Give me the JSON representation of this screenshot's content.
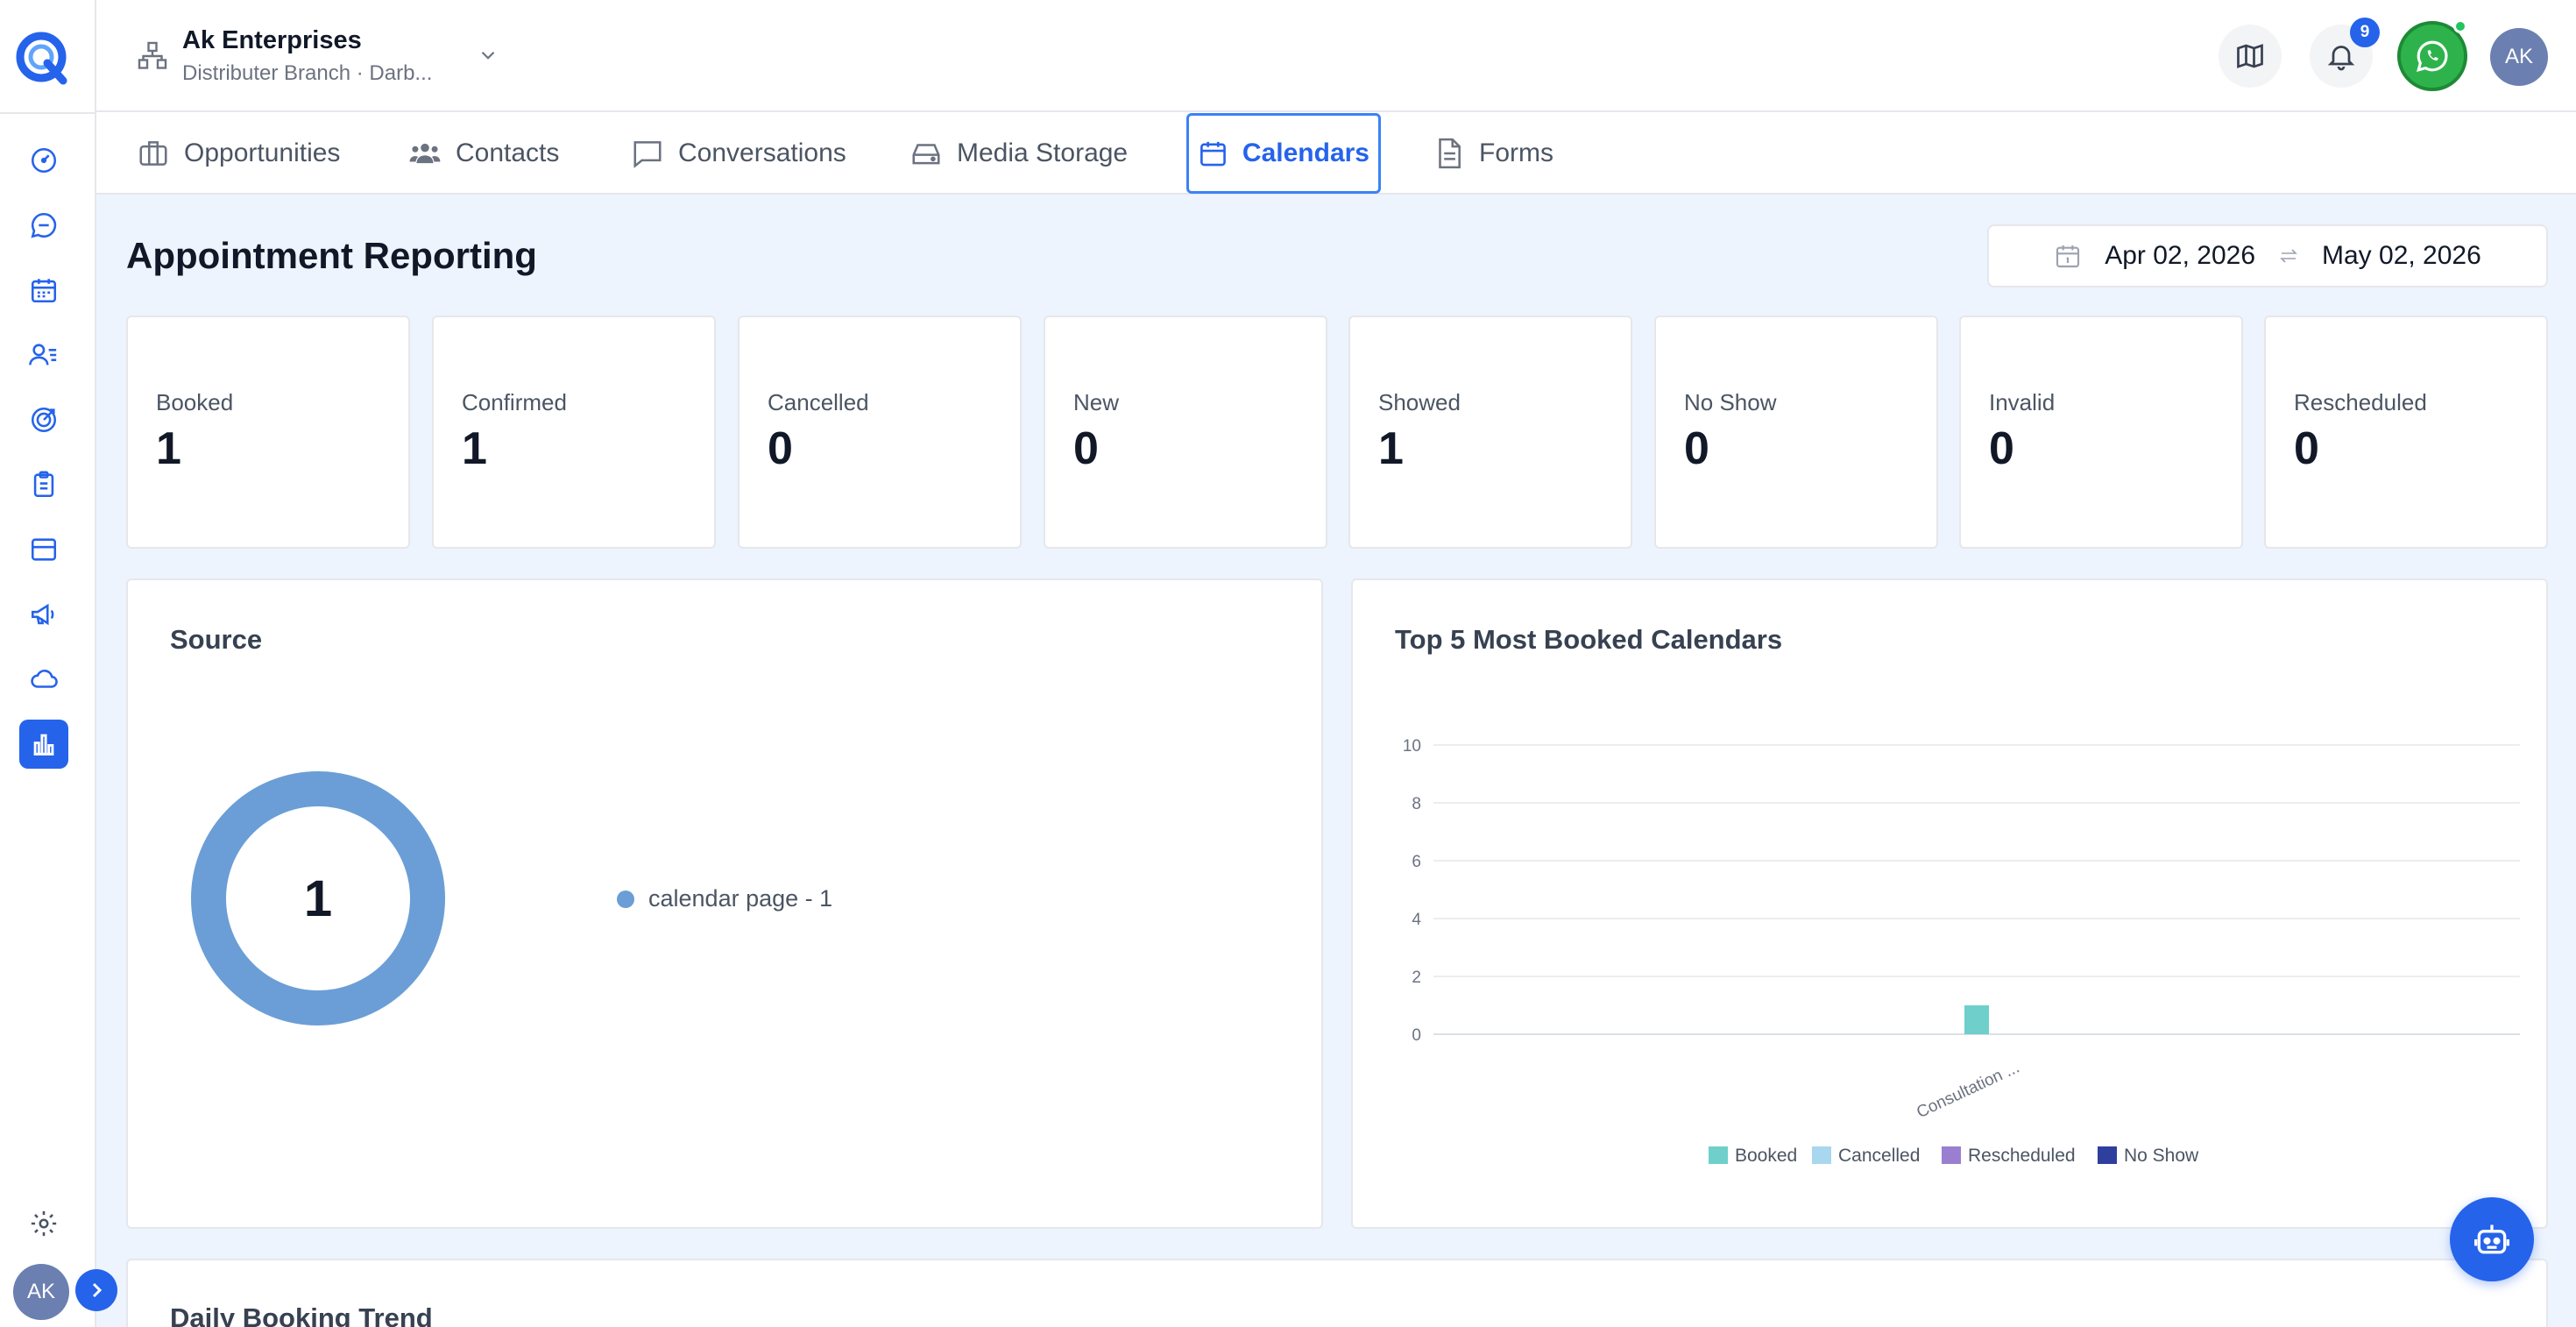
{
  "header": {
    "org_name": "Ak Enterprises",
    "org_sub": "Distributer Branch · Darb...",
    "notification_count": "9",
    "avatar_initials": "AK"
  },
  "sidebar": {
    "avatar_initials": "AK",
    "items": [
      {
        "icon": "dashboard-icon"
      },
      {
        "icon": "chat-icon"
      },
      {
        "icon": "calendar-icon"
      },
      {
        "icon": "contacts-icon"
      },
      {
        "icon": "target-icon"
      },
      {
        "icon": "clipboard-icon"
      },
      {
        "icon": "payments-icon"
      },
      {
        "icon": "megaphone-icon"
      },
      {
        "icon": "cloud-icon"
      },
      {
        "icon": "reporting-icon",
        "active": true
      }
    ]
  },
  "tabs": [
    {
      "label": "Opportunities",
      "icon": "briefcase-icon"
    },
    {
      "label": "Contacts",
      "icon": "users-icon"
    },
    {
      "label": "Conversations",
      "icon": "message-icon"
    },
    {
      "label": "Media Storage",
      "icon": "storage-icon"
    },
    {
      "label": "Calendars",
      "icon": "calendar-icon",
      "active": true
    },
    {
      "label": "Forms",
      "icon": "document-icon"
    }
  ],
  "page": {
    "title": "Appointment Reporting",
    "date_start": "Apr 02, 2026",
    "date_end": "May 02, 2026"
  },
  "stats": [
    {
      "label": "Booked",
      "value": "1"
    },
    {
      "label": "Confirmed",
      "value": "1"
    },
    {
      "label": "Cancelled",
      "value": "0"
    },
    {
      "label": "New",
      "value": "0"
    },
    {
      "label": "Showed",
      "value": "1"
    },
    {
      "label": "No Show",
      "value": "0"
    },
    {
      "label": "Invalid",
      "value": "0"
    },
    {
      "label": "Rescheduled",
      "value": "0"
    }
  ],
  "source_panel": {
    "title": "Source",
    "total": "1",
    "legend": "calendar page - 1"
  },
  "top_calendars_panel": {
    "title": "Top 5 Most Booked Calendars"
  },
  "bottom_panel": {
    "title": "Daily Booking Trend"
  },
  "colors": {
    "accent": "#2563eb",
    "donut": "#6b9ed6",
    "booked": "#6fcfcb",
    "cancelled": "#a8d8ef",
    "rescheduled": "#9a7fd1",
    "no_show": "#2f3f9e"
  },
  "chart_data": [
    {
      "type": "pie",
      "title": "Source",
      "categories": [
        "calendar page"
      ],
      "values": [
        1
      ]
    },
    {
      "type": "bar",
      "title": "Top 5 Most Booked Calendars",
      "categories": [
        "Consultation ..."
      ],
      "series": [
        {
          "name": "Booked",
          "values": [
            1
          ],
          "color": "#6fcfcb"
        },
        {
          "name": "Cancelled",
          "values": [
            0
          ],
          "color": "#a8d8ef"
        },
        {
          "name": "Rescheduled",
          "values": [
            0
          ],
          "color": "#9a7fd1"
        },
        {
          "name": "No Show",
          "values": [
            0
          ],
          "color": "#2f3f9e"
        }
      ],
      "ylim": [
        0,
        10
      ],
      "yticks": [
        "0",
        "2",
        "4",
        "6",
        "8",
        "10"
      ],
      "grid": true,
      "legend": "bottom"
    }
  ]
}
